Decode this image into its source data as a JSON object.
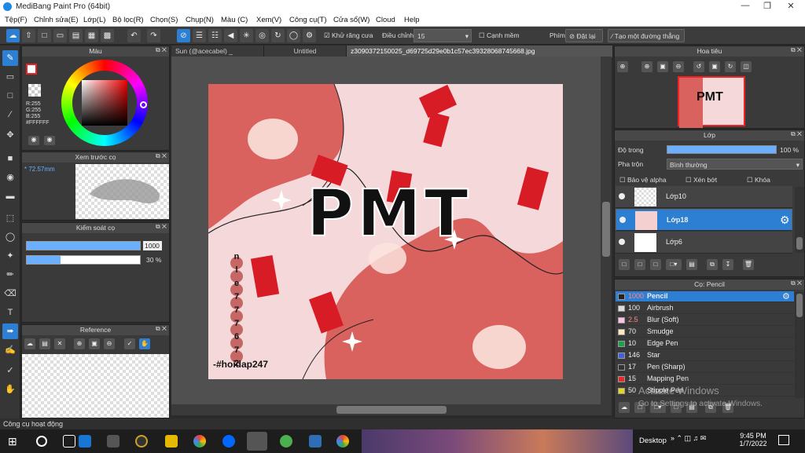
{
  "window": {
    "title": "MediBang Paint Pro (64bit)"
  },
  "menu": [
    "Tệp(F)",
    "Chỉnh sửa(E)",
    "Lớp(L)",
    "Bộ lọc(R)",
    "Chọn(S)",
    "Chụp(N)",
    "Màu (C)",
    "Xem(V)",
    "Công cụ(T)",
    "Cửa sổ(W)",
    "Cloud",
    "Help"
  ],
  "toolbar": {
    "antialias_label": "Khử răng cưa",
    "adjust_label": "Điều chỉnh",
    "adjust_value": "15",
    "edge_label": "Cạnh mềm",
    "pen_label": "Phím",
    "reset_label": "Đặt lại",
    "straight_label": "Tạo một đường thẳng"
  },
  "tabs": [
    "Sun (@acecabel) _ Twitter.jpg",
    "Untitled",
    "z3090372150025_d69725d29e0b1c57ec39328068745668.jpg"
  ],
  "color_panel": {
    "title": "Màu",
    "r": "R:255",
    "g": "G:255",
    "b": "B:255",
    "hex": "#FFFFFF"
  },
  "brush_preview": {
    "title": "Xem trước cọ",
    "size": "72.57mm"
  },
  "brush_control": {
    "title": "Kiểm soát cọ",
    "size_value": "1000",
    "opacity_value": "30 %"
  },
  "reference": {
    "title": "Reference"
  },
  "navigator": {
    "title": "Hoa tiêu"
  },
  "layer_panel": {
    "title": "Lớp",
    "opacity_label": "Độ trong",
    "opacity_value": "100 %",
    "blend_label": "Pha trộn",
    "blend_value": "Bình thường",
    "protect_alpha": "Bảo vệ alpha",
    "clipping": "Xén bớt",
    "lock": "Khóa"
  },
  "layers": [
    {
      "name": "Lớp10",
      "selected": false
    },
    {
      "name": "Lớp18",
      "selected": true
    },
    {
      "name": "Lớp6",
      "selected": false
    }
  ],
  "brush_panel": {
    "title": "Cọ: Pencil"
  },
  "brushes": [
    {
      "size": "1000",
      "name": "Pencil",
      "color": "#222222",
      "selected": true
    },
    {
      "size": "100",
      "name": "Airbrush",
      "color": "#dddddd",
      "selected": false
    },
    {
      "size": "2.5",
      "name": "Blur (Soft)",
      "color": "#ffbfe6",
      "selected": false
    },
    {
      "size": "70",
      "name": "Smudge",
      "color": "#ffe8c0",
      "selected": false
    },
    {
      "size": "10",
      "name": "Edge Pen",
      "color": "#1aa34a",
      "selected": false
    },
    {
      "size": "146",
      "name": "Star",
      "color": "#3f63d6",
      "selected": false
    },
    {
      "size": "17",
      "name": "Pen (Sharp)",
      "color": "#333333",
      "selected": false
    },
    {
      "size": "15",
      "name": "Mapping Pen",
      "color": "#e32b2b",
      "selected": false
    },
    {
      "size": "50",
      "name": "Stipple Pen",
      "color": "#e6d51f",
      "selected": false
    }
  ],
  "artwork": {
    "title": "PMT",
    "side_text": [
      "n",
      "l",
      "e",
      "7",
      "7",
      "7",
      "6",
      "7",
      "2"
    ],
    "hashtag": "-#hoidap247"
  },
  "status": {
    "text": "Công cụ hoạt động"
  },
  "taskbar": {
    "desktop_label": "Desktop",
    "time": "9:45 PM",
    "date": "1/7/2022",
    "watermark1": "Activate Windows",
    "watermark2": "Go to Settings to activate Windows."
  },
  "colors": {
    "accent": "#2d7fd3",
    "art_bg": "#f5d9da",
    "art_red": "#d9625f"
  }
}
